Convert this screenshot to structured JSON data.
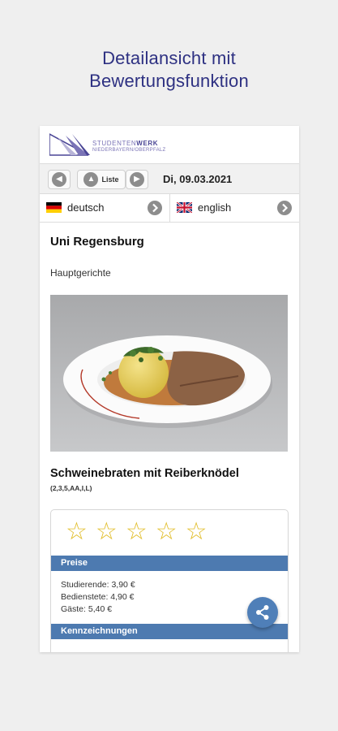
{
  "promo": {
    "line1": "Detailansicht mit",
    "line2": "Bewertungsfunktion"
  },
  "header": {
    "logo_brand_light": "STUDENTEN",
    "logo_brand_bold": "WERK",
    "logo_region": "NIEDERBAYERN/OBERPFALZ"
  },
  "nav": {
    "prev_icon": "arrow-left-icon",
    "list_label": "Liste",
    "list_icon": "arrow-up-icon",
    "next_icon": "arrow-right-icon",
    "date": "Di, 09.03.2021"
  },
  "languages": [
    {
      "label": "deutsch",
      "flag": "german-flag"
    },
    {
      "label": "english",
      "flag": "uk-flag"
    }
  ],
  "content": {
    "canteen": "Uni Regensburg",
    "category": "Hauptgerichte",
    "dish_name": "Schweinebraten mit Reiberknödel",
    "dish_codes": "(2,3,5,AA,I,L)"
  },
  "rating": {
    "max_stars": 5,
    "selected": 0,
    "star_glyph": "☆"
  },
  "prices": {
    "title": "Preise",
    "students": "Studierende: 3,90 €",
    "staff": "Bedienstete: 4,90 €",
    "guests": "Gäste: 5,40 €"
  },
  "labels_section": {
    "title": "Kennzeichnungen"
  },
  "colors": {
    "accent": "#4d7ab0",
    "promo_text": "#2e3182",
    "star": "#e1bd2a"
  }
}
